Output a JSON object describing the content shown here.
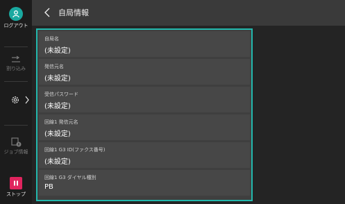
{
  "sidebar": {
    "logout_label": "ログアウト",
    "interrupt_label": "割り込み",
    "job_info_label": "ジョブ情報",
    "stop_label": "ストップ"
  },
  "header": {
    "title": "自局情報"
  },
  "settings": [
    {
      "label": "自局名",
      "value": "(未設定)"
    },
    {
      "label": "発信元名",
      "value": "(未設定)"
    },
    {
      "label": "受信パスワード",
      "value": "(未設定)"
    },
    {
      "label": "回線1 発信元名",
      "value": "(未設定)"
    },
    {
      "label": "回線1 G3 ID(ファクス番号)",
      "value": "(未設定)"
    },
    {
      "label": "回線1 G3 ダイヤル種別",
      "value": "PB"
    }
  ],
  "colors": {
    "accent": "#1aa9a0",
    "focus_border": "#22b8ad",
    "stop": "#e0245e"
  },
  "icons": [
    "logout-icon",
    "interrupt-icon",
    "settings-gear-icon",
    "chevron-right-icon",
    "job-info-icon",
    "stop-icon",
    "back-arrow-icon"
  ]
}
